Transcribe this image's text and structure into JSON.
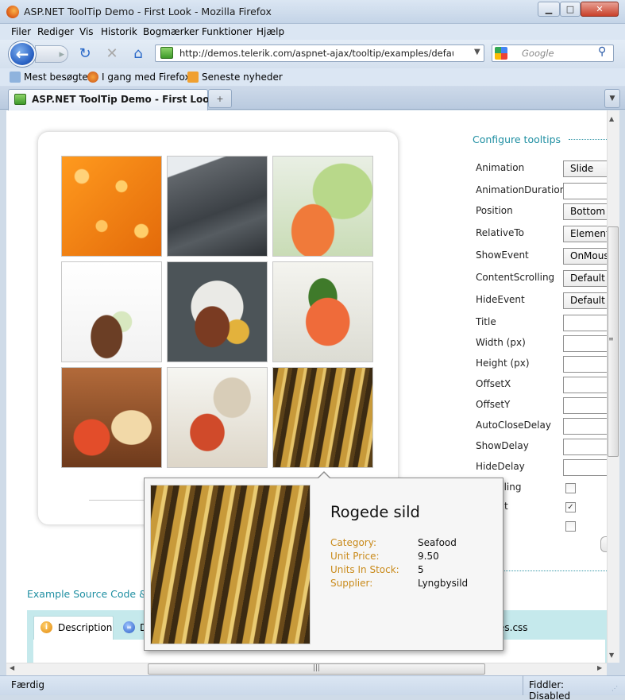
{
  "window": {
    "title": "ASP.NET ToolTip Demo - First Look - Mozilla Firefox",
    "controls": {
      "minimize": "▁",
      "maximize": "□",
      "close": "✕"
    }
  },
  "menu": {
    "items": [
      "Filer",
      "Rediger",
      "Vis",
      "Historik",
      "Bogmærker",
      "Funktioner",
      "Hjælp"
    ]
  },
  "navigation": {
    "url": "http://demos.telerik.com/aspnet-ajax/tooltip/examples/default/defaultcs.aspx",
    "search_placeholder": "Google",
    "icons": {
      "back": "back-arrow-icon",
      "forward": "forward-arrow-icon",
      "reload": "reload-icon",
      "stop": "stop-icon",
      "home": "home-icon"
    }
  },
  "bookmarks": {
    "items": [
      "Mest besøgte",
      "I gang med Firefox",
      "Seneste nyheder"
    ]
  },
  "tab": {
    "label": "ASP.NET ToolTip Demo - First Look",
    "new_tab": "+"
  },
  "config": {
    "title": "Configure tooltips",
    "rows": [
      {
        "label": "Animation",
        "value": "Slide",
        "kind": "select"
      },
      {
        "label": "AnimationDuration",
        "value": "",
        "kind": "text"
      },
      {
        "label": "Position",
        "value": "Bottom",
        "kind": "select"
      },
      {
        "label": "RelativeTo",
        "value": "Element",
        "kind": "select"
      },
      {
        "label": "ShowEvent",
        "value": "OnMouse",
        "kind": "select"
      },
      {
        "label": "ContentScrolling",
        "value": "Default",
        "kind": "select"
      },
      {
        "label": "HideEvent",
        "value": "Default",
        "kind": "select"
      },
      {
        "label": "Title",
        "value": "",
        "kind": "text"
      },
      {
        "label": "Width (px)",
        "value": "",
        "kind": "text"
      },
      {
        "label": "Height (px)",
        "value": "",
        "kind": "text"
      },
      {
        "label": "OffsetX",
        "value": "",
        "kind": "text"
      },
      {
        "label": "OffsetY",
        "value": "",
        "kind": "text"
      },
      {
        "label": "AutoCloseDelay",
        "value": "",
        "kind": "text"
      },
      {
        "label": "ShowDelay",
        "value": "",
        "kind": "text"
      },
      {
        "label": "HideDelay",
        "value": "",
        "kind": "text"
      }
    ],
    "checks": [
      {
        "label": "eTrailing",
        "checked": false
      },
      {
        "label": "allout",
        "checked": true
      },
      {
        "label": "",
        "checked": false
      }
    ]
  },
  "example": {
    "title": "Example Source Code &",
    "tabs": [
      {
        "label": "Description",
        "icon": "info-icon"
      },
      {
        "label": "D",
        "icon": "list-icon"
      },
      {
        "label": "es.css",
        "icon": ""
      }
    ]
  },
  "tooltip": {
    "title": "Rogede sild",
    "fields": [
      {
        "key": "Category:",
        "value": "Seafood"
      },
      {
        "key": "Unit Price:",
        "value": "9.50"
      },
      {
        "key": "Units In Stock:",
        "value": "5"
      },
      {
        "key": "Supplier:",
        "value": "Lyngbysild"
      }
    ]
  },
  "gallery": {
    "items": [
      "salmon-roe-image",
      "dark-stone-image",
      "salmon-cucumber-image",
      "meat-garnish-image",
      "duck-plate-image",
      "smoked-salmon-image",
      "sushi-image",
      "clams-pasta-image",
      "smoked-herring-image"
    ]
  },
  "status": {
    "text": "Færdig",
    "fiddler": "Fiddler: Disabled"
  },
  "colors": {
    "accent": "#1f8fa2",
    "tooltip_key": "#c98a1a",
    "tab_strip": "#c5e9ec"
  }
}
